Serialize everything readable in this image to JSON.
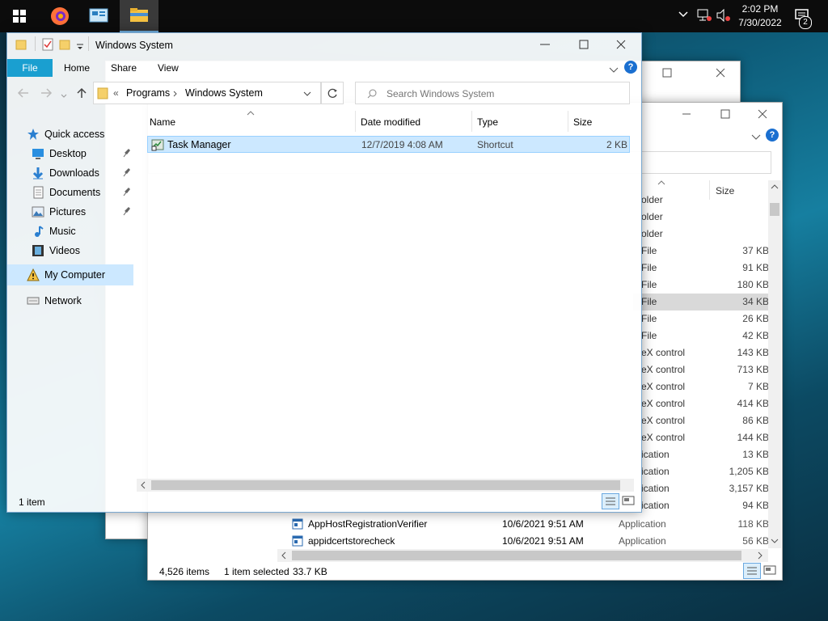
{
  "taskbar": {
    "clock_time": "2:02 PM",
    "clock_date": "7/30/2022",
    "notification_count": "2"
  },
  "main_window": {
    "title": "Windows System",
    "ribbon": {
      "file": "File",
      "home": "Home",
      "share": "Share",
      "view": "View"
    },
    "breadcrumb": {
      "root": "Programs",
      "current": "Windows System",
      "overflow": "«"
    },
    "search_placeholder": "Search Windows System",
    "columns": {
      "name": "Name",
      "date": "Date modified",
      "type": "Type",
      "size": "Size"
    },
    "files": [
      {
        "name": "Task Manager",
        "date": "12/7/2019 4:08 AM",
        "type": "Shortcut",
        "size": "2 KB"
      }
    ],
    "nav": {
      "quick_access": "Quick access",
      "desktop": "Desktop",
      "downloads": "Downloads",
      "documents": "Documents",
      "pictures": "Pictures",
      "music": "Music",
      "videos": "Videos",
      "my_computer": "My Computer",
      "network": "Network"
    },
    "status": "1 item"
  },
  "back_window": {
    "size_header": "Size",
    "rows": [
      {
        "type": "older",
        "size": ""
      },
      {
        "type": "older",
        "size": ""
      },
      {
        "type": "older",
        "size": ""
      },
      {
        "type": "File",
        "size": "37 KB"
      },
      {
        "type": "File",
        "size": "91 KB"
      },
      {
        "type": "File",
        "size": "180 KB"
      },
      {
        "type": "File",
        "size": "34 KB"
      },
      {
        "type": "File",
        "size": "26 KB"
      },
      {
        "type": "File",
        "size": "42 KB"
      },
      {
        "type": "eX control",
        "size": "143 KB"
      },
      {
        "type": "eX control",
        "size": "713 KB"
      },
      {
        "type": "eX control",
        "size": "7 KB"
      },
      {
        "type": "eX control",
        "size": "414 KB"
      },
      {
        "type": "eX control",
        "size": "86 KB"
      },
      {
        "type": "eX control",
        "size": "144 KB"
      },
      {
        "type": "ication",
        "size": "13 KB"
      },
      {
        "type": "ication",
        "size": "1,205 KB"
      },
      {
        "type": "ication",
        "size": "3,157 KB"
      },
      {
        "type": "ication",
        "size": "94 KB"
      }
    ],
    "visible_files": [
      {
        "name": "AppHostRegistrationVerifier",
        "date": "10/6/2021 9:51 AM",
        "type": "Application",
        "size": "118 KB"
      },
      {
        "name": "appidcertstorecheck",
        "date": "10/6/2021 9:51 AM",
        "type": "Application",
        "size": "56 KB"
      }
    ],
    "status_items": "4,526 items",
    "status_selected": "1 item selected",
    "status_size": "33.7 KB"
  }
}
